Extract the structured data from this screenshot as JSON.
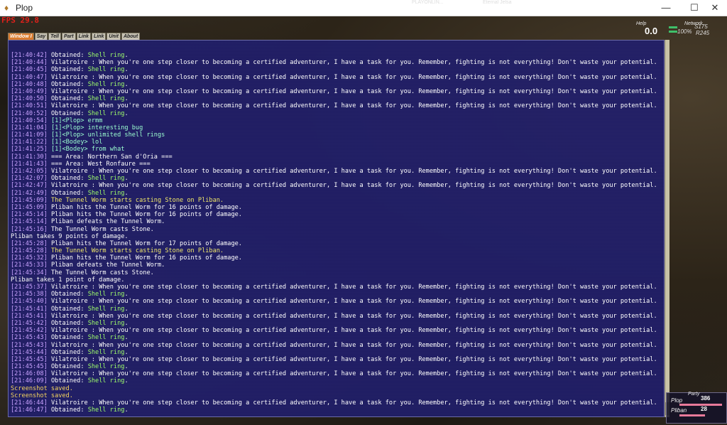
{
  "window": {
    "title": "Plop",
    "fps": "FPS 29.8"
  },
  "taskbar_hints": [
    "PLAYONLIN...",
    "Eternal Jelsa"
  ],
  "tabs": [
    {
      "label": "Window I",
      "active": true
    },
    {
      "label": "Say",
      "active": false
    },
    {
      "label": "Tell",
      "active": false
    },
    {
      "label": "Part",
      "active": false
    },
    {
      "label": "Link",
      "active": false
    },
    {
      "label": "Link",
      "active": false
    },
    {
      "label": "Unit",
      "active": false
    },
    {
      "label": "About",
      "active": false
    }
  ],
  "help": {
    "label": "Help",
    "value": "0.0"
  },
  "network": {
    "label": "Network",
    "line1": "S175",
    "line2_pct": "100%",
    "line2_r": "R245"
  },
  "party": {
    "label": "Party",
    "members": [
      {
        "name": "Plop",
        "hp": "386",
        "hp_fraction": 1.0
      },
      {
        "name": "Pliban",
        "hp": "28",
        "hp_fraction": 0.6
      }
    ]
  },
  "chat_lines": [
    {
      "ts": "[21:40:42]",
      "text": "Obtained: ",
      "item": "Shell ring",
      "tail": ".",
      "type": "obtain"
    },
    {
      "ts": "[21:40:44]",
      "text": "Vilatroire : When you're one step closer to becoming a certified adventurer, I have a task for you. Remember, fighting is not everything! Don't waste your potential.",
      "type": "npc"
    },
    {
      "ts": "[21:40:45]",
      "text": "Obtained: ",
      "item": "Shell ring",
      "tail": ".",
      "type": "obtain"
    },
    {
      "ts": "[21:40:47]",
      "text": "Vilatroire : When you're one step closer to becoming a certified adventurer, I have a task for you. Remember, fighting is not everything! Don't waste your potential.",
      "type": "npc"
    },
    {
      "ts": "[21:40:48]",
      "text": "Obtained: ",
      "item": "Shell ring",
      "tail": ".",
      "type": "obtain"
    },
    {
      "ts": "[21:40:49]",
      "text": "Vilatroire : When you're one step closer to becoming a certified adventurer, I have a task for you. Remember, fighting is not everything! Don't waste your potential.",
      "type": "npc"
    },
    {
      "ts": "[21:40:50]",
      "text": "Obtained: ",
      "item": "Shell ring",
      "tail": ".",
      "type": "obtain"
    },
    {
      "ts": "[21:40:51]",
      "text": "Vilatroire : When you're one step closer to becoming a certified adventurer, I have a task for you. Remember, fighting is not everything! Don't waste your potential.",
      "type": "npc"
    },
    {
      "ts": "[21:40:52]",
      "text": "Obtained: ",
      "item": "Shell ring",
      "tail": ".",
      "type": "obtain"
    },
    {
      "ts": "[21:40:54]",
      "text": "[1]<Plop> ermm",
      "type": "party"
    },
    {
      "ts": "[21:41:04]",
      "text": "[1]<Plop> interesting bug",
      "type": "party"
    },
    {
      "ts": "[21:41:09]",
      "text": "[1]<Plop> unlimited shell rings",
      "type": "party"
    },
    {
      "ts": "[21:41:22]",
      "text": "[1]<Bodey> lol",
      "type": "party"
    },
    {
      "ts": "[21:41:25]",
      "text": "[1]<Bodey> from what",
      "type": "party"
    },
    {
      "ts": "[21:41:30]",
      "text": "=== Area: Northern San d'Oria ===",
      "type": "sys"
    },
    {
      "ts": "[21:41:43]",
      "text": "=== Area: West Ronfaure ===",
      "type": "sys"
    },
    {
      "ts": "[21:42:05]",
      "text": "Vilatroire : When you're one step closer to becoming a certified adventurer, I have a task for you. Remember, fighting is not everything! Don't waste your potential.",
      "type": "npc"
    },
    {
      "ts": "[21:42:07]",
      "text": "Obtained: ",
      "item": "Shell ring",
      "tail": ".",
      "type": "obtain"
    },
    {
      "ts": "[21:42:47]",
      "text": "Vilatroire : When you're one step closer to becoming a certified adventurer, I have a task for you. Remember, fighting is not everything! Don't waste your potential.",
      "type": "npc"
    },
    {
      "ts": "[21:42:49]",
      "text": "Obtained: ",
      "item": "Shell ring",
      "tail": ".",
      "type": "obtain"
    },
    {
      "ts": "[21:45:09]",
      "text": "The Tunnel Worm starts casting Stone on Pliban.",
      "type": "worm"
    },
    {
      "ts": "[21:45:09]",
      "text": "Pliban hits the Tunnel Worm for 16 points of damage.",
      "type": "sys"
    },
    {
      "ts": "[21:45:14]",
      "text": "Pliban hits the Tunnel Worm for 16 points of damage.",
      "type": "sys"
    },
    {
      "ts": "[21:45:14]",
      "text": "Pliban defeats the Tunnel Worm.",
      "type": "sys"
    },
    {
      "ts": "[21:45:16]",
      "text": "The Tunnel Worm casts Stone.",
      "type": "sys"
    },
    {
      "ts": "",
      "text": "Pliban takes 9 points of damage.",
      "type": "plain"
    },
    {
      "ts": "[21:45:28]",
      "text": "Pliban hits the Tunnel Worm for 17 points of damage.",
      "type": "sys"
    },
    {
      "ts": "[21:45:28]",
      "text": "The Tunnel Worm starts casting Stone on Pliban.",
      "type": "worm"
    },
    {
      "ts": "[21:45:32]",
      "text": "Pliban hits the Tunnel Worm for 16 points of damage.",
      "type": "sys"
    },
    {
      "ts": "[21:45:33]",
      "text": "Pliban defeats the Tunnel Worm.",
      "type": "sys"
    },
    {
      "ts": "[21:45:34]",
      "text": "The Tunnel Worm casts Stone.",
      "type": "sys"
    },
    {
      "ts": "",
      "text": "Pliban takes 1 point of damage.",
      "type": "plain"
    },
    {
      "ts": "[21:45:37]",
      "text": "Vilatroire : When you're one step closer to becoming a certified adventurer, I have a task for you. Remember, fighting is not everything! Don't waste your potential.",
      "type": "npc"
    },
    {
      "ts": "[21:45:38]",
      "text": "Obtained: ",
      "item": "Shell ring",
      "tail": ".",
      "type": "obtain"
    },
    {
      "ts": "[21:45:40]",
      "text": "Vilatroire : When you're one step closer to becoming a certified adventurer, I have a task for you. Remember, fighting is not everything! Don't waste your potential.",
      "type": "npc"
    },
    {
      "ts": "[21:45:41]",
      "text": "Obtained: ",
      "item": "Shell ring",
      "tail": ".",
      "type": "obtain"
    },
    {
      "ts": "[21:45:41]",
      "text": "Vilatroire : When you're one step closer to becoming a certified adventurer, I have a task for you. Remember, fighting is not everything! Don't waste your potential.",
      "type": "npc"
    },
    {
      "ts": "[21:45:42]",
      "text": "Obtained: ",
      "item": "Shell ring",
      "tail": ".",
      "type": "obtain"
    },
    {
      "ts": "[21:45:42]",
      "text": "Vilatroire : When you're one step closer to becoming a certified adventurer, I have a task for you. Remember, fighting is not everything! Don't waste your potential.",
      "type": "npc"
    },
    {
      "ts": "[21:45:43]",
      "text": "Obtained: ",
      "item": "Shell ring",
      "tail": ".",
      "type": "obtain"
    },
    {
      "ts": "[21:45:43]",
      "text": "Vilatroire : When you're one step closer to becoming a certified adventurer, I have a task for you. Remember, fighting is not everything! Don't waste your potential.",
      "type": "npc"
    },
    {
      "ts": "[21:45:44]",
      "text": "Obtained: ",
      "item": "Shell ring",
      "tail": ".",
      "type": "obtain"
    },
    {
      "ts": "[21:45:45]",
      "text": "Vilatroire : When you're one step closer to becoming a certified adventurer, I have a task for you. Remember, fighting is not everything! Don't waste your potential.",
      "type": "npc"
    },
    {
      "ts": "[21:45:45]",
      "text": "Obtained: ",
      "item": "Shell ring",
      "tail": ".",
      "type": "obtain"
    },
    {
      "ts": "[21:46:08]",
      "text": "Vilatroire : When you're one step closer to becoming a certified adventurer, I have a task for you. Remember, fighting is not everything! Don't waste your potential.",
      "type": "npc"
    },
    {
      "ts": "[21:46:09]",
      "text": "Obtained: ",
      "item": "Shell ring",
      "tail": ".",
      "type": "obtain"
    },
    {
      "ts": "",
      "text": "Screenshot saved.",
      "type": "shot"
    },
    {
      "ts": "",
      "text": "Screenshot saved.",
      "type": "shot"
    },
    {
      "ts": "[21:46:44]",
      "text": "Vilatroire : When you're one step closer to becoming a certified adventurer, I have a task for you. Remember, fighting is not everything! Don't waste your potential.",
      "type": "npc"
    },
    {
      "ts": "[21:46:47]",
      "text": "Obtained: ",
      "item": "Shell ring",
      "tail": ".",
      "type": "obtain"
    }
  ]
}
